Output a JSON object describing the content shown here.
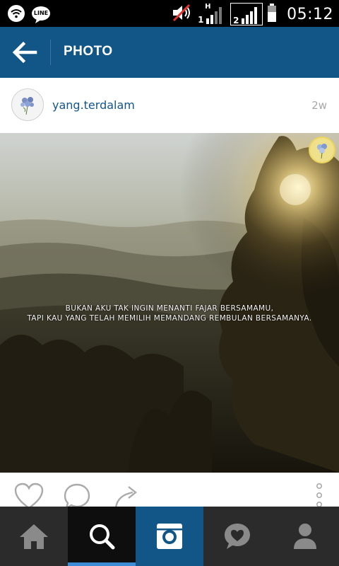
{
  "status_bar": {
    "time": "05:12",
    "sim1_label": "1",
    "sim1_network": "H",
    "sim2_label": "2",
    "icons": [
      "wifi-icon",
      "line-app-icon",
      "mute-icon",
      "signal-icon",
      "battery-icon"
    ],
    "line_label": "LINE"
  },
  "app_bar": {
    "title": "PHOTO",
    "back_icon": "arrow-left-icon",
    "color": "#125688"
  },
  "post": {
    "username": "yang.terdalam",
    "time_ago": "2w",
    "caption_line1": "BUKAN AKU TAK INGIN MENANTI FAJAR BERSAMAMU,",
    "caption_line2": "TAPI KAU YANG TELAH MEMILIH MEMANDANG REMBULAN BERSAMANYA."
  },
  "actions": {
    "icons": [
      "heart-icon",
      "comment-icon",
      "share-icon",
      "more-vertical-icon"
    ]
  },
  "bottom_nav": {
    "items": [
      {
        "name": "home",
        "icon": "home-icon",
        "selected": false
      },
      {
        "name": "search",
        "icon": "search-icon",
        "selected": true
      },
      {
        "name": "camera",
        "icon": "camera-icon",
        "selected": false
      },
      {
        "name": "activity",
        "icon": "heart-bubble-icon",
        "selected": false
      },
      {
        "name": "profile",
        "icon": "profile-icon",
        "selected": false
      }
    ],
    "accent": "#3c8cd8"
  }
}
